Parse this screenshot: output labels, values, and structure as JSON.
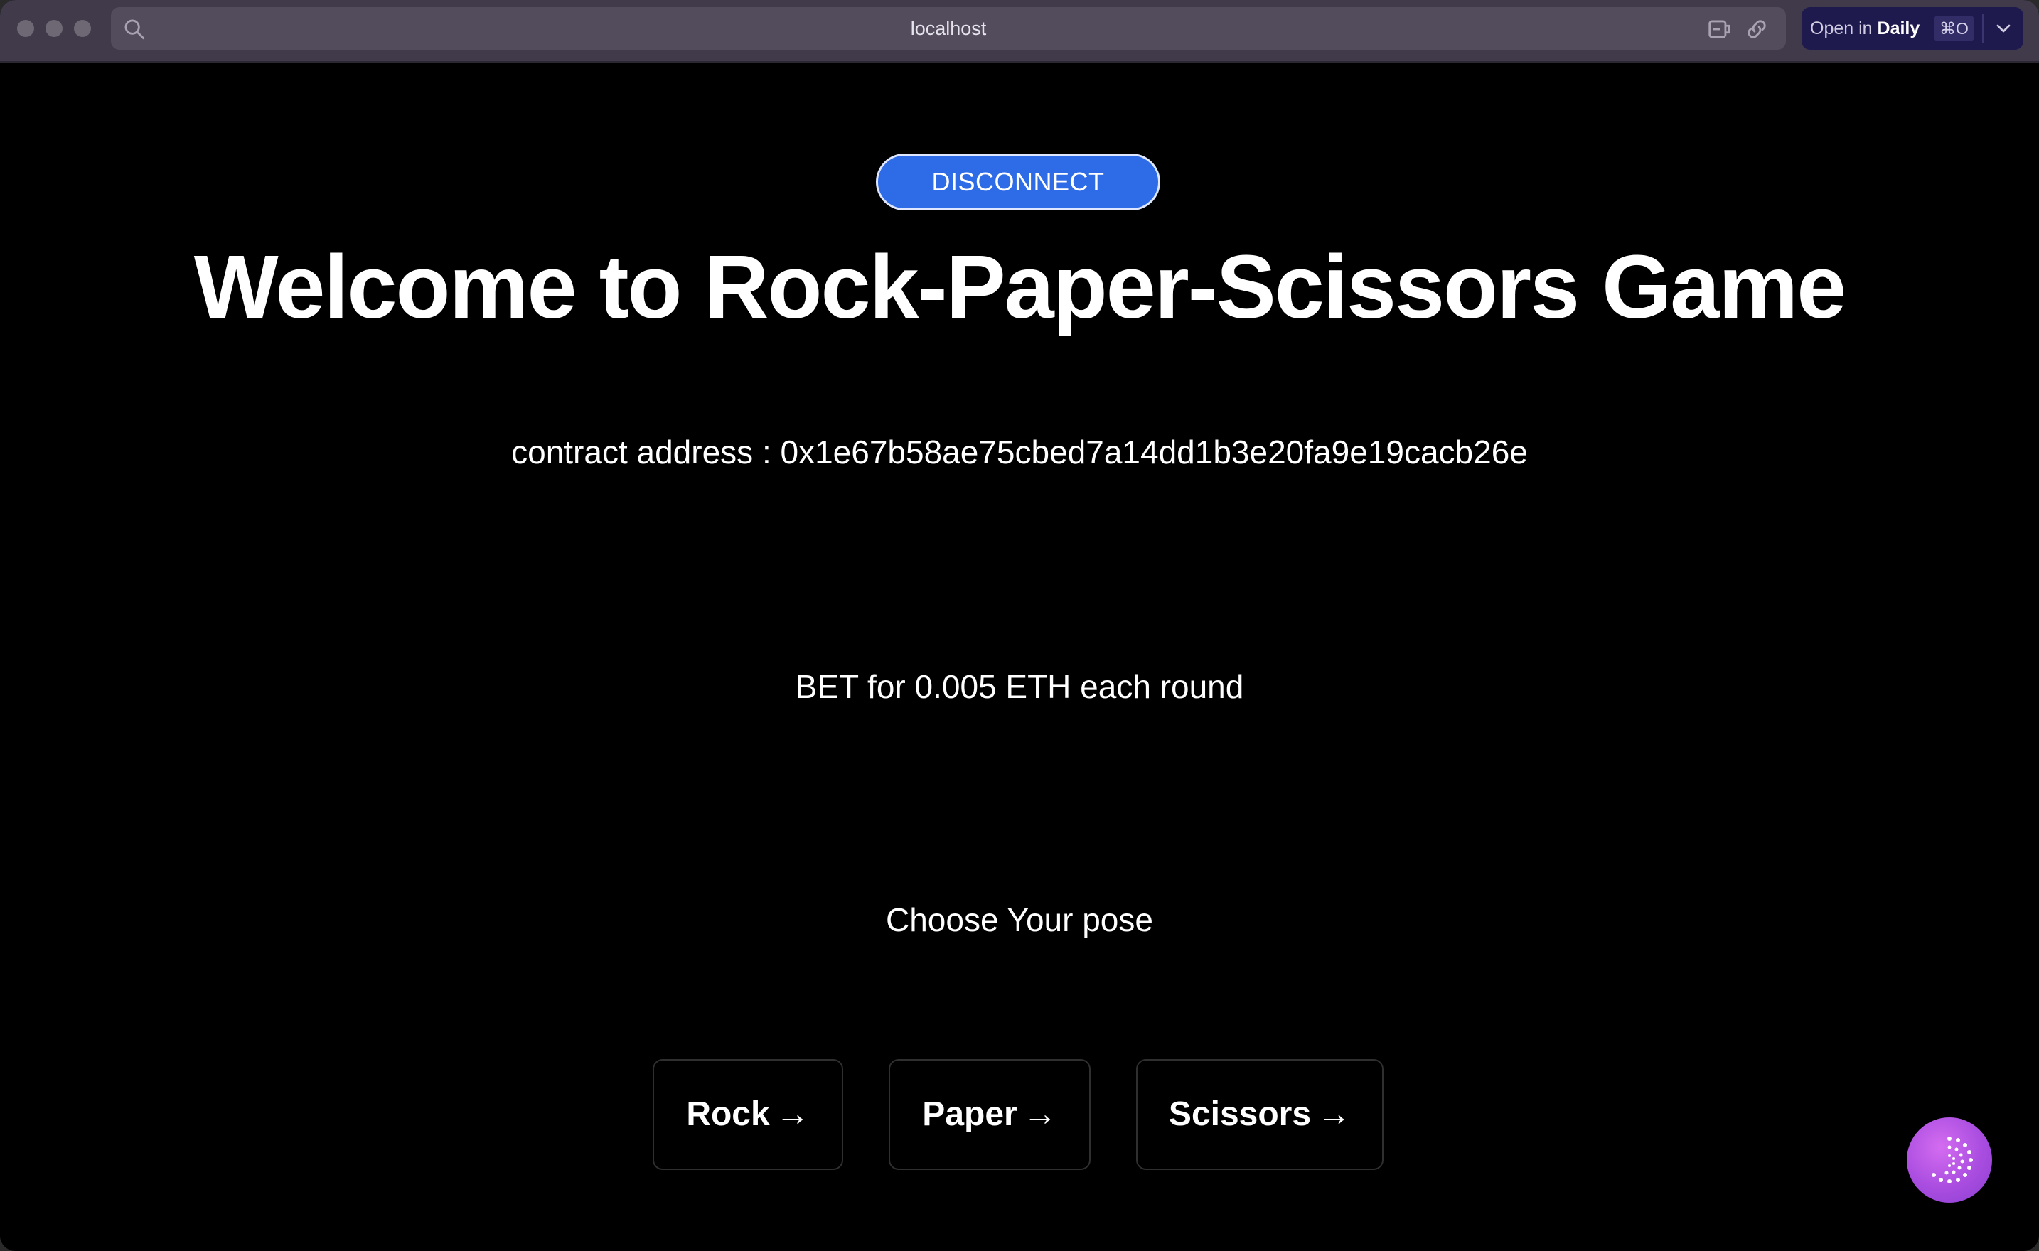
{
  "browser": {
    "url": "localhost",
    "open_in_prefix": "Open in",
    "open_in_app": "Daily",
    "open_in_shortcut": "⌘O"
  },
  "page": {
    "disconnect_label": "DISCONNECT",
    "title": "Welcome to Rock-Paper-Scissors Game",
    "contract_address": "contract address : 0x1e67b58ae75cbed7a14dd1b3e20fa9e19cacb26e",
    "bet_text": "BET for 0.005 ETH each round",
    "choose_text": "Choose Your pose",
    "poses": [
      {
        "label": "Rock",
        "arrow": "→"
      },
      {
        "label": "Paper",
        "arrow": "→"
      },
      {
        "label": "Scissors",
        "arrow": "→"
      }
    ]
  },
  "colors": {
    "accent_button": "#2e6be6",
    "background": "#000000",
    "fab_gradient": "#a94de0"
  },
  "icons": [
    "search-icon",
    "reader-mode-icon",
    "link-icon",
    "chevron-down-icon",
    "assistant-fab-icon"
  ]
}
